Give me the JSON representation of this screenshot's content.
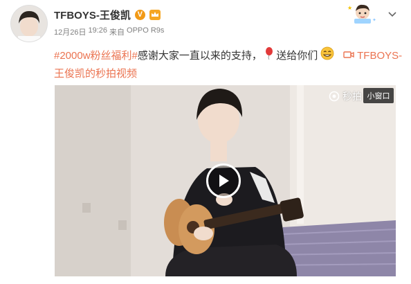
{
  "post": {
    "username": "TFBOYS-王俊凯",
    "verified_icon": "verified-v-icon",
    "verified_glyph": "V",
    "vip_icon": "vip-crown-icon",
    "date": "12月26日",
    "time": "19:26",
    "source_prefix": "来自",
    "source": "OPPO R9s",
    "text": {
      "topic": "#2000w粉丝福利#",
      "body": "感谢大家一直以来的支持，",
      "balloon_icon": "red-balloon-icon",
      "gift_text": "送给你们",
      "smile_icon": "smile-emoji-icon",
      "video_link": "TFBOYS-王俊凯的秒拍视频",
      "video_link_icon": "video-camera-icon"
    }
  },
  "video": {
    "watermark": "秒拍",
    "mini_window_label": "小窗口",
    "play_icon": "play-icon"
  },
  "colors": {
    "accent": "#eb7350",
    "username": "#333333",
    "meta": "#808080",
    "verified": "#f29a16"
  }
}
